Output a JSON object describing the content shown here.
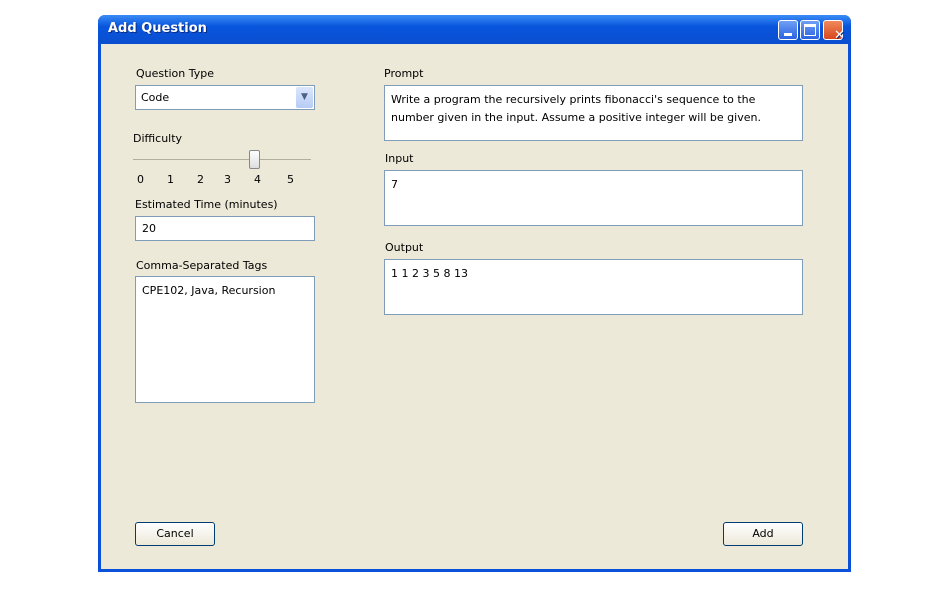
{
  "window": {
    "title": "Add Question",
    "minimize_icon": "minimize-icon",
    "maximize_icon": "maximize-icon",
    "close_icon": "close-icon"
  },
  "question_type": {
    "label": "Question Type",
    "value": "Code"
  },
  "difficulty": {
    "label": "Difficulty",
    "ticks": [
      "0",
      "1",
      "2",
      "3",
      "4",
      "5"
    ],
    "value": 4,
    "max": 5
  },
  "estimated_time": {
    "label": "Estimated Time (minutes)",
    "value": "20"
  },
  "tags": {
    "label": "Comma-Separated Tags",
    "value": "CPE102, Java, Recursion"
  },
  "prompt": {
    "label": "Prompt",
    "value": "Write a program the recursively prints fibonacci's sequence to the number given in the input. Assume a positive integer will be given."
  },
  "input": {
    "label": "Input",
    "value": "7"
  },
  "output": {
    "label": "Output",
    "value": "1 1 2 3 5 8 13"
  },
  "buttons": {
    "cancel": "Cancel",
    "add": "Add"
  }
}
